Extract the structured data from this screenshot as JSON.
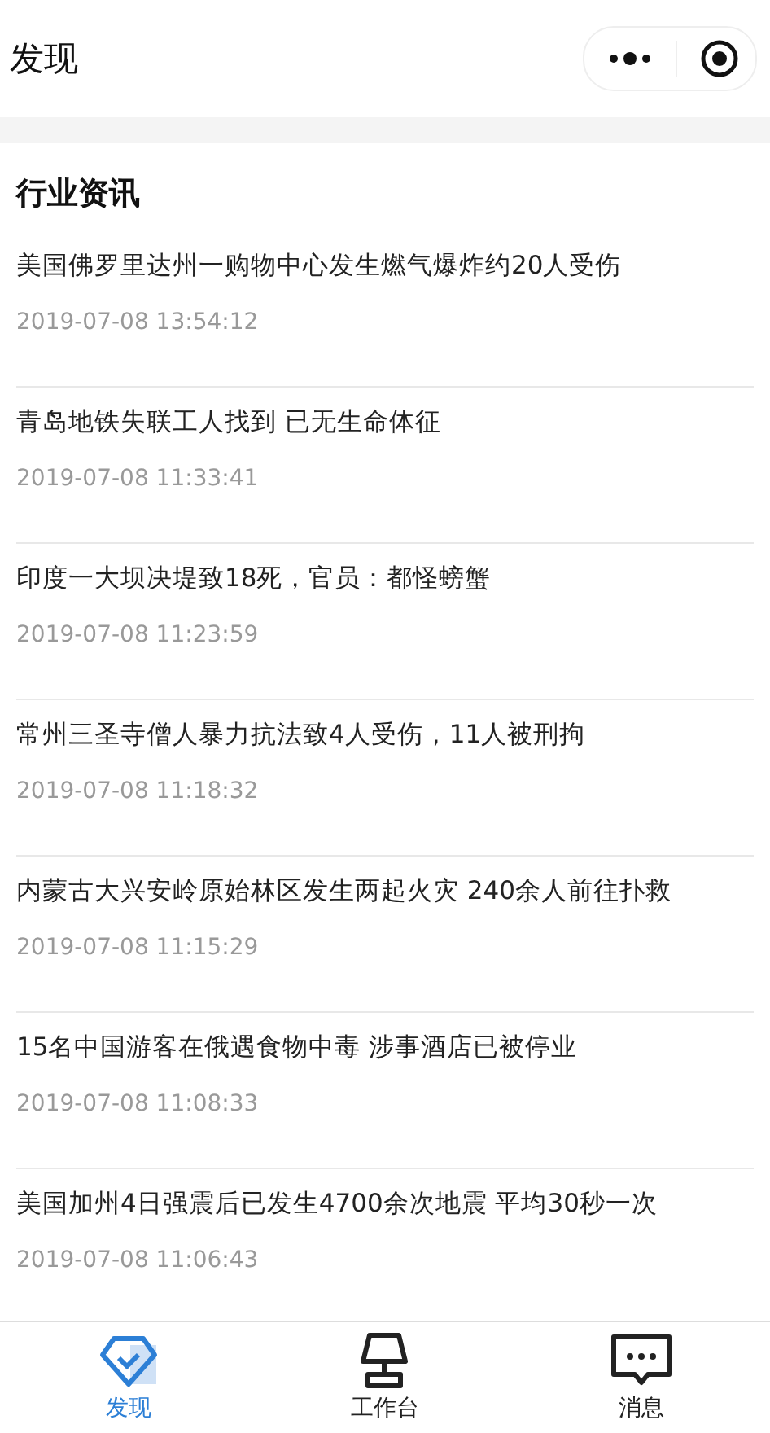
{
  "header": {
    "title": "发现"
  },
  "section": {
    "title": "行业资讯"
  },
  "news": [
    {
      "title": "美国佛罗里达州一购物中心发生燃气爆炸约20人受伤",
      "time": "2019-07-08 13:54:12"
    },
    {
      "title": "青岛地铁失联工人找到 已无生命体征",
      "time": "2019-07-08 11:33:41"
    },
    {
      "title": "印度一大坝决堤致18死，官员：都怪螃蟹",
      "time": "2019-07-08 11:23:59"
    },
    {
      "title": "常州三圣寺僧人暴力抗法致4人受伤，11人被刑拘",
      "time": "2019-07-08 11:18:32"
    },
    {
      "title": "内蒙古大兴安岭原始林区发生两起火灾 240余人前往扑救",
      "time": "2019-07-08 11:15:29"
    },
    {
      "title": "15名中国游客在俄遇食物中毒 涉事酒店已被停业",
      "time": "2019-07-08 11:08:33"
    },
    {
      "title": "美国加州4日强震后已发生4700余次地震 平均30秒一次",
      "time": "2019-07-08 11:06:43"
    }
  ],
  "tabs": [
    {
      "label": "发现",
      "kind": "discover",
      "selected": true
    },
    {
      "label": "工作台",
      "kind": "desk",
      "selected": false
    },
    {
      "label": "消息",
      "kind": "message",
      "selected": false
    }
  ]
}
